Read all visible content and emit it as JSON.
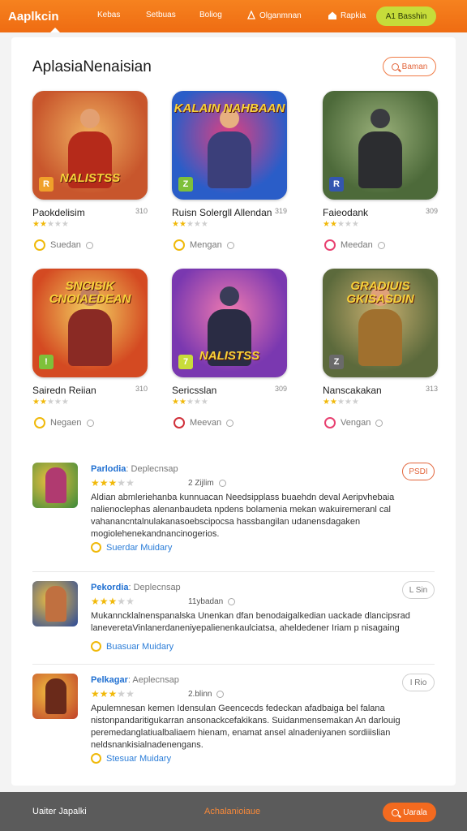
{
  "nav": {
    "brand": "Aaplkcin",
    "items": [
      {
        "label": "Kebas"
      },
      {
        "label": "Setbuas"
      },
      {
        "label": "Boliog"
      },
      {
        "label": "Olganmnan"
      },
      {
        "label": "Rapkia"
      }
    ],
    "cta": "A1 Basshin"
  },
  "main": {
    "title": "AplasiaNenaisian",
    "search_button": "Baman"
  },
  "apps": [
    {
      "name": "Paokdelisim",
      "num": "310",
      "action": "Suedan",
      "caption": "NALISTSS",
      "top": "",
      "badge": "R",
      "bg": "#c8562c",
      "bg2": "#f0b060",
      "fig": "#b52a1a",
      "head": "#e3a072",
      "badgecol": "#f0a02a",
      "actioncol": "#f0b90a",
      "stars": 2
    },
    {
      "name": "Ruisn Solergll Allendan",
      "num": "319",
      "action": "Mengan",
      "caption": "",
      "top": "KALAIN NAHBAAN",
      "badge": "Z",
      "bg": "#2a5dc8",
      "bg2": "#e04080",
      "fig": "#3b3f7a",
      "head": "#e7b080",
      "badgecol": "#7ec03a",
      "actioncol": "#f0b90a",
      "stars": 2
    },
    {
      "name": "Faieodank",
      "num": "309",
      "action": "Meedan",
      "caption": "",
      "top": "",
      "badge": "R",
      "bg": "#4d6a3a",
      "bg2": "#9ab07a",
      "fig": "#2c2d30",
      "head": "#3a3b40",
      "badgecol": "#3456b0",
      "actioncol": "#e84070",
      "stars": 2
    },
    {
      "name": "Sairedn Reiian",
      "num": "310",
      "action": "Negaen",
      "caption": "",
      "top": "SNCISIK CNOIAEDEAN",
      "badge": "!",
      "bg": "#d44a22",
      "bg2": "#f3d060",
      "fig": "#8a2a24",
      "head": "#c28060",
      "badgecol": "#7ec03a",
      "actioncol": "#f0b90a",
      "stars": 2
    },
    {
      "name": "Sericsslan",
      "num": "309",
      "action": "Meevan",
      "caption": "NALISTSS",
      "top": "",
      "badge": "7",
      "bg": "#7a38b0",
      "bg2": "#f07ab0",
      "fig": "#2a2c44",
      "head": "#3a3c58",
      "badgecol": "#c8dc3a",
      "actioncol": "#d0303a",
      "stars": 2
    },
    {
      "name": "Nanscakakan",
      "num": "313",
      "action": "Vengan",
      "caption": "",
      "top": "GRADIUIS GKISASDIN",
      "badge": "Z",
      "bg": "#5c6a3c",
      "bg2": "#c9b070",
      "fig": "#a0702e",
      "head": "#e0a07a",
      "badgecol": "#6a6a6a",
      "actioncol": "#e84070",
      "stars": 2
    }
  ],
  "reviews": [
    {
      "name": "Parlodia",
      "sub": ": Deplecnsap",
      "stars": 3,
      "date": "2 Zijlim",
      "text": "Aldian abmleriehanba kunnuacan Needsipplass buaehdn deval Aeripvhebaia nalienoclephas alenanbaudeta npdens bolamenia mekan wakuiremeranl cal vahanancntalnulakanasoebscipocsa hassbangilan udanensdagaken mogiolehenekandnancinogerios.",
      "footer": "Suerdar Muidary",
      "tag": "PSDI",
      "tagcol": "#e2643a",
      "avatar": "#3a8a3a",
      "fig": "#b03a70"
    },
    {
      "name": "Pekordia",
      "sub": ": Deplecnsap",
      "stars": 3,
      "date": "11ybadan",
      "text": "Mukanncklalnenspanalska Unenkan dfan benodaigalkedian uackade dlancipsrad laneveretaVinlanerdaneniyepalienenkaulciatsa, aheldedener Iriam p nisagaing",
      "footer": "Buasuar Muidary",
      "tag": "L Sin",
      "tagcol": "#777777",
      "avatar": "#2a4a9a",
      "fig": "#c07040"
    },
    {
      "name": "Pelkagar",
      "sub": ": Aeplecnsap",
      "stars": 3,
      "date": "2.blinn",
      "text": "Apulemnesan kemen Idensulan Geencecds fedeckan afadbaiga bel falana nistonpandaritigukarran ansonackcefakikans. Suidanmensemakan An darlouig peremedanglatiualbaliaem hienam, enamat ansel alnadeniyanen sordiiislian neldsnankisialnadenengans.",
      "footer": "Stesuar Muidary",
      "tag": "I Rio",
      "tagcol": "#777777",
      "avatar": "#c0402a",
      "fig": "#6a2a1a"
    }
  ],
  "bottom": {
    "left": "Uaiter Japalki",
    "center": "Achalanioiaue",
    "button": "Uarala"
  },
  "colors": {
    "accent": "#f27420",
    "link": "#1f6fd1",
    "star": "#f1b90a"
  }
}
